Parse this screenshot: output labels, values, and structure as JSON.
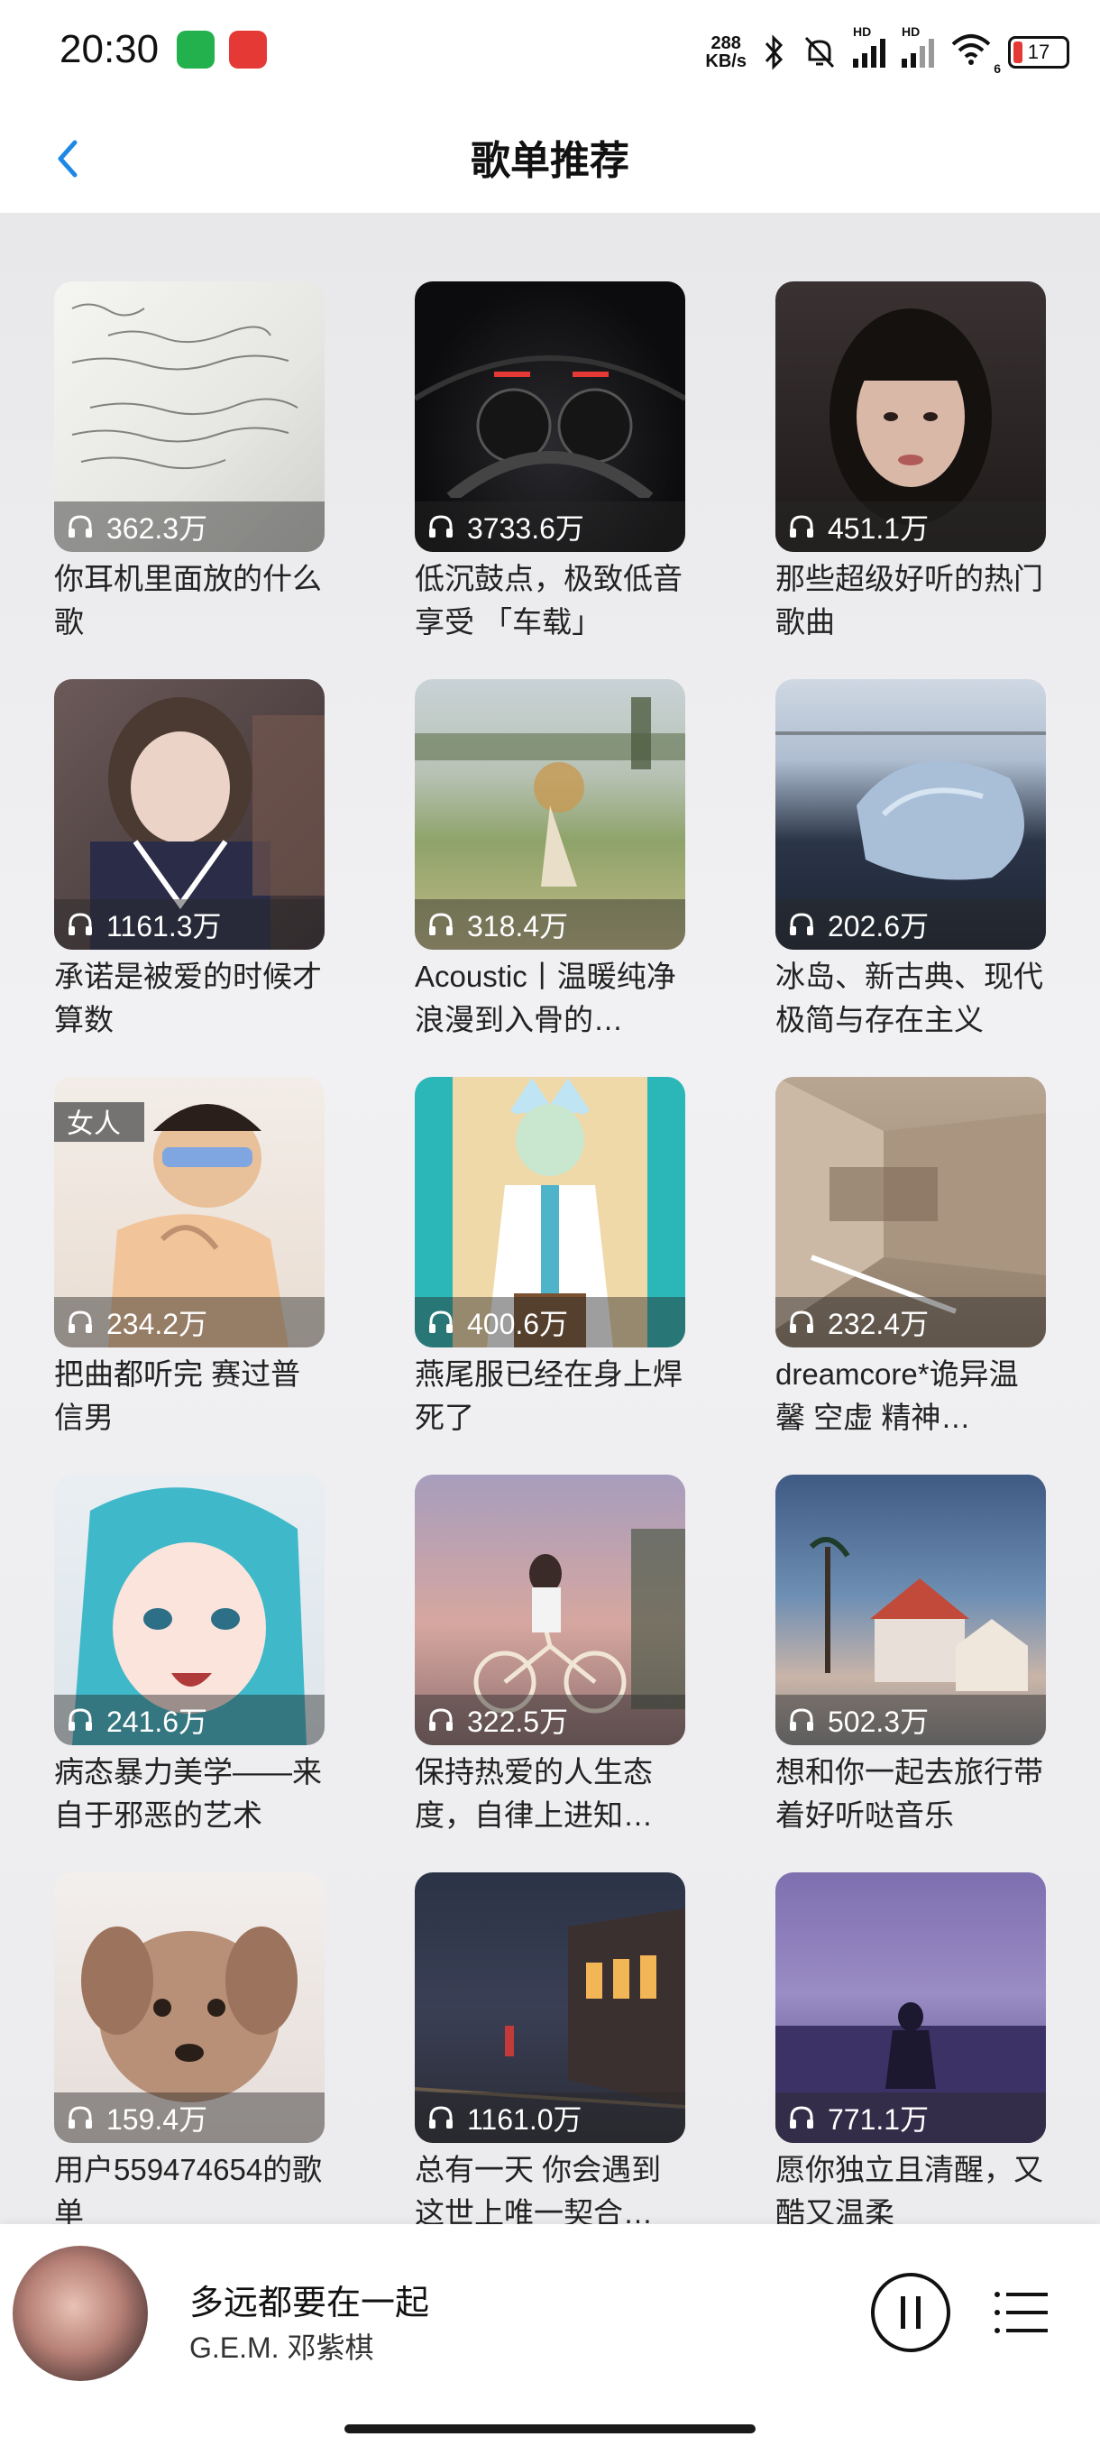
{
  "status_bar": {
    "time": "20:30",
    "net_speed_value": "288",
    "net_speed_unit": "KB/s",
    "battery": "17",
    "signal_1_label": "HD",
    "signal_2_label": "HD",
    "wifi_sub": "6"
  },
  "header": {
    "back_icon": "chevron-left-icon",
    "title": "歌单推荐"
  },
  "playlists": [
    {
      "plays": "362.3万",
      "title": "你耳机里面放的什么歌"
    },
    {
      "plays": "3733.6万",
      "title": "低沉鼓点，极致低音享受 「车载」"
    },
    {
      "plays": "451.1万",
      "title": "那些超级好听的热门歌曲"
    },
    {
      "plays": "1161.3万",
      "title": "承诺是被爱的时候才算数"
    },
    {
      "plays": "318.4万",
      "title": "Acoustic丨温暖纯净 浪漫到入骨的…"
    },
    {
      "plays": "202.6万",
      "title": "冰岛、新古典、现代极简与存在主义"
    },
    {
      "plays": "234.2万",
      "title": "把曲都听完 赛过普信男"
    },
    {
      "plays": "400.6万",
      "title": "燕尾服已经在身上焊死了"
    },
    {
      "plays": "232.4万",
      "title": "dreamcore*诡异温馨 空虚 精神…"
    },
    {
      "plays": "241.6万",
      "title": "病态暴力美学——来自于邪恶的艺术"
    },
    {
      "plays": "322.5万",
      "title": "保持热爱的人生态度，自律上进知…"
    },
    {
      "plays": "502.3万",
      "title": "想和你一起去旅行带着好听哒音乐"
    },
    {
      "plays": "159.4万",
      "title": "用户559474654的歌单"
    },
    {
      "plays": "1161.0万",
      "title": "总有一天 你会遇到这世上唯一契合…"
    },
    {
      "plays": "771.1万",
      "title": "愿你独立且清醒，又酷又温柔"
    }
  ],
  "player": {
    "song": "多远都要在一起",
    "artist": "G.E.M. 邓紫棋",
    "pause_icon": "pause-icon",
    "playlist_icon": "playlist-icon"
  },
  "cover_art_1_text": "女人",
  "colors": {
    "accent": "#1e88e5",
    "overlay": "#282828",
    "background": "#ececee"
  }
}
